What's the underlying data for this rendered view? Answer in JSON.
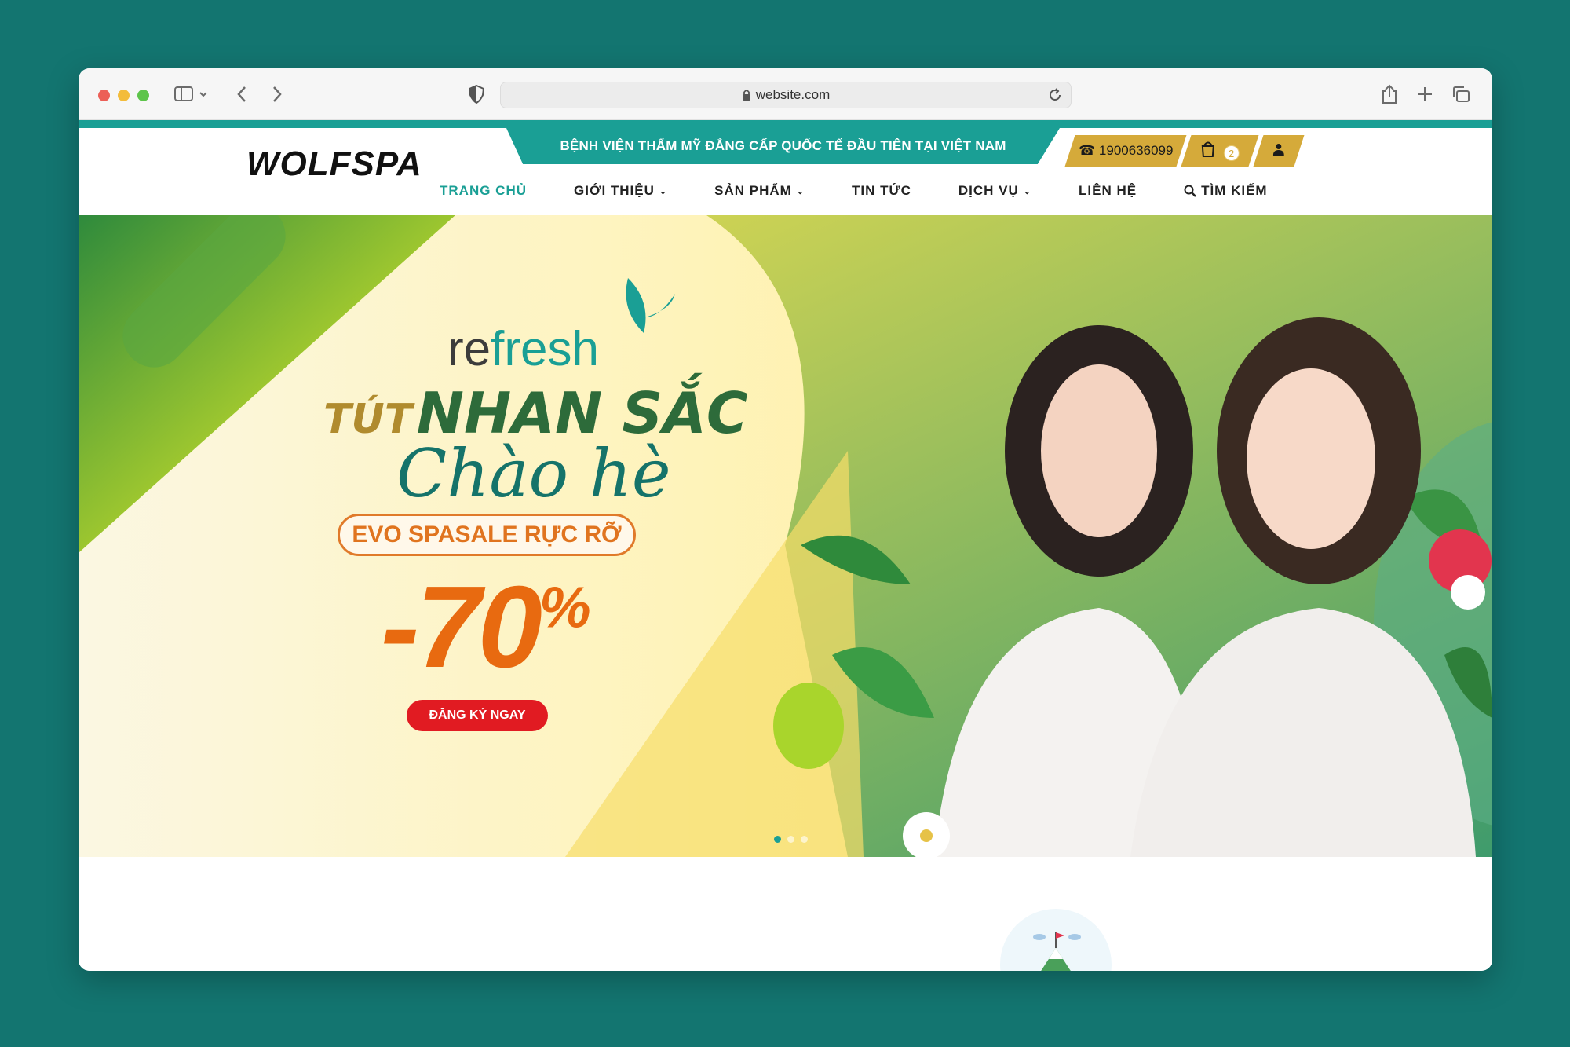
{
  "browser": {
    "url": "website.com"
  },
  "site": {
    "logo": "WOLFSPA",
    "promo": "BỆNH VIỆN THẨM MỸ ĐẲNG CẤP QUỐC TẾ ĐẦU TIÊN TẠI VIỆT NAM",
    "phone": "1900636099",
    "cart_count": "2",
    "nav": [
      {
        "label": "TRANG CHỦ",
        "active": true
      },
      {
        "label": "GIỚI THIỆU",
        "dropdown": true
      },
      {
        "label": "SẢN PHẨM",
        "dropdown": true
      },
      {
        "label": "TIN TỨC"
      },
      {
        "label": "DỊCH VỤ",
        "dropdown": true
      },
      {
        "label": "LIÊN HỆ"
      },
      {
        "label": "TÌM KIẾM",
        "icon": "search-icon"
      }
    ]
  },
  "hero": {
    "brand_prefix": "re",
    "brand_suffix": "fresh",
    "headline_part1": "TÚT",
    "headline_part2": "NHAN SẮC",
    "subhead": "Chào hè",
    "evo_label": "EVO SPASALE RỰC RỠ",
    "discount": "-70",
    "discount_unit": "%",
    "cta": "ĐĂNG KÝ NGAY"
  },
  "colors": {
    "brand_teal": "#1a9f95",
    "gold": "#d5aa3a",
    "discount_orange": "#e86a10",
    "cta_red": "#e11b22"
  }
}
